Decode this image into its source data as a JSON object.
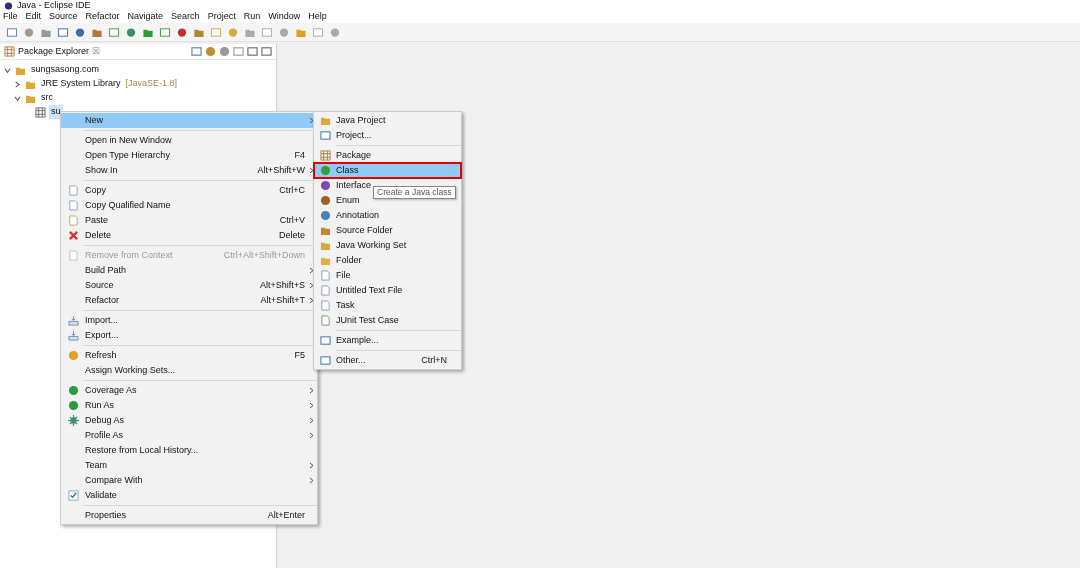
{
  "window": {
    "title": "Java - Eclipse IDE"
  },
  "menubar": [
    "File",
    "Edit",
    "Source",
    "Refactor",
    "Navigate",
    "Search",
    "Project",
    "Run",
    "Window",
    "Help"
  ],
  "package_explorer": {
    "title": "Package Explorer",
    "close": "☒",
    "tree": [
      {
        "label": "sungsasong.com",
        "expanded": true,
        "selected": false,
        "children": [
          {
            "label": "JRE System Library",
            "suffix": "[JavaSE-1.8]",
            "expanded": false,
            "selected": false
          },
          {
            "label": "src",
            "expanded": true,
            "selected": false,
            "children": [
              {
                "label": "su",
                "selected": true
              }
            ]
          }
        ]
      }
    ]
  },
  "context_menu": {
    "items": [
      {
        "kind": "item",
        "label": "New",
        "submenu": true,
        "selected": true,
        "disabled": false
      },
      {
        "kind": "separator"
      },
      {
        "kind": "item",
        "label": "Open in New Window",
        "selected": false,
        "disabled": false
      },
      {
        "kind": "item",
        "label": "Open Type Hierarchy",
        "shortcut": "F4",
        "selected": false,
        "disabled": false
      },
      {
        "kind": "item",
        "label": "Show In",
        "shortcut": "Alt+Shift+W",
        "submenu": true,
        "selected": false,
        "disabled": false
      },
      {
        "kind": "separator"
      },
      {
        "kind": "item",
        "label": "Copy",
        "shortcut": "Ctrl+C",
        "selected": false,
        "disabled": false
      },
      {
        "kind": "item",
        "label": "Copy Qualified Name",
        "selected": false,
        "disabled": false
      },
      {
        "kind": "item",
        "label": "Paste",
        "shortcut": "Ctrl+V",
        "selected": false,
        "disabled": false
      },
      {
        "kind": "item",
        "label": "Delete",
        "shortcut": "Delete",
        "selected": false,
        "disabled": false
      },
      {
        "kind": "separator"
      },
      {
        "kind": "item",
        "label": "Remove from Context",
        "shortcut": "Ctrl+Alt+Shift+Down",
        "selected": false,
        "disabled": true
      },
      {
        "kind": "item",
        "label": "Build Path",
        "submenu": true,
        "selected": false,
        "disabled": false
      },
      {
        "kind": "item",
        "label": "Source",
        "shortcut": "Alt+Shift+S",
        "submenu": true,
        "selected": false,
        "disabled": false
      },
      {
        "kind": "item",
        "label": "Refactor",
        "shortcut": "Alt+Shift+T",
        "submenu": true,
        "selected": false,
        "disabled": false
      },
      {
        "kind": "separator"
      },
      {
        "kind": "item",
        "label": "Import...",
        "selected": false,
        "disabled": false
      },
      {
        "kind": "item",
        "label": "Export...",
        "selected": false,
        "disabled": false
      },
      {
        "kind": "separator"
      },
      {
        "kind": "item",
        "label": "Refresh",
        "shortcut": "F5",
        "selected": false,
        "disabled": false
      },
      {
        "kind": "item",
        "label": "Assign Working Sets...",
        "selected": false,
        "disabled": false
      },
      {
        "kind": "separator"
      },
      {
        "kind": "item",
        "label": "Coverage As",
        "submenu": true,
        "selected": false,
        "disabled": false
      },
      {
        "kind": "item",
        "label": "Run As",
        "submenu": true,
        "selected": false,
        "disabled": false
      },
      {
        "kind": "item",
        "label": "Debug As",
        "submenu": true,
        "selected": false,
        "disabled": false
      },
      {
        "kind": "item",
        "label": "Profile As",
        "submenu": true,
        "selected": false,
        "disabled": false
      },
      {
        "kind": "item",
        "label": "Restore from Local History...",
        "selected": false,
        "disabled": false
      },
      {
        "kind": "item",
        "label": "Team",
        "submenu": true,
        "selected": false,
        "disabled": false
      },
      {
        "kind": "item",
        "label": "Compare With",
        "submenu": true,
        "selected": false,
        "disabled": false
      },
      {
        "kind": "item",
        "label": "Validate",
        "selected": false,
        "disabled": false
      },
      {
        "kind": "separator"
      },
      {
        "kind": "item",
        "label": "Properties",
        "shortcut": "Alt+Enter",
        "selected": false,
        "disabled": false
      }
    ]
  },
  "new_submenu": {
    "items": [
      {
        "kind": "item",
        "label": "Java Project",
        "selected": false
      },
      {
        "kind": "item",
        "label": "Project...",
        "selected": false
      },
      {
        "kind": "separator"
      },
      {
        "kind": "item",
        "label": "Package",
        "selected": false
      },
      {
        "kind": "item",
        "label": "Class",
        "selected": true
      },
      {
        "kind": "item",
        "label": "Interface",
        "selected": false
      },
      {
        "kind": "item",
        "label": "Enum",
        "selected": false
      },
      {
        "kind": "item",
        "label": "Annotation",
        "selected": false
      },
      {
        "kind": "item",
        "label": "Source Folder",
        "selected": false
      },
      {
        "kind": "item",
        "label": "Java Working Set",
        "selected": false
      },
      {
        "kind": "item",
        "label": "Folder",
        "selected": false
      },
      {
        "kind": "item",
        "label": "File",
        "selected": false
      },
      {
        "kind": "item",
        "label": "Untitled Text File",
        "selected": false
      },
      {
        "kind": "item",
        "label": "Task",
        "selected": false
      },
      {
        "kind": "item",
        "label": "JUnit Test Case",
        "selected": false
      },
      {
        "kind": "separator"
      },
      {
        "kind": "item",
        "label": "Example...",
        "selected": false
      },
      {
        "kind": "separator"
      },
      {
        "kind": "item",
        "label": "Other...",
        "shortcut": "Ctrl+N",
        "selected": false
      }
    ]
  },
  "tooltip": "Create a Java class"
}
